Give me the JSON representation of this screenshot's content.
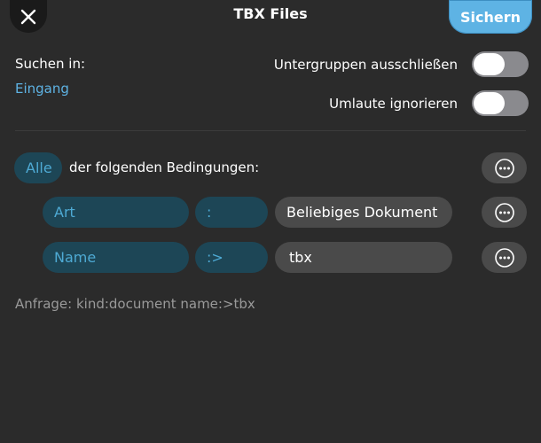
{
  "header": {
    "title": "TBX Files",
    "save_label": "Sichern"
  },
  "search_in": {
    "label": "Suchen in:",
    "value": "Eingang"
  },
  "toggles": [
    {
      "label": "Untergruppen ausschließen",
      "on": false
    },
    {
      "label": "Umlaute ignorieren",
      "on": false
    }
  ],
  "conditions": {
    "quantifier": "Alle",
    "suffix": "der folgenden Bedingungen:",
    "rows": [
      {
        "field": "Art",
        "operator": ":",
        "value": "Beliebiges Dokument"
      },
      {
        "field": "Name",
        "operator": ":>",
        "value": "tbx"
      }
    ]
  },
  "query": "Anfrage: kind:document name:>tbx",
  "colors": {
    "accent": "#5eb3e4",
    "pill_blue_bg": "#1d4656",
    "pill_blue_text": "#4eaad4",
    "background": "#2b2b2b"
  }
}
